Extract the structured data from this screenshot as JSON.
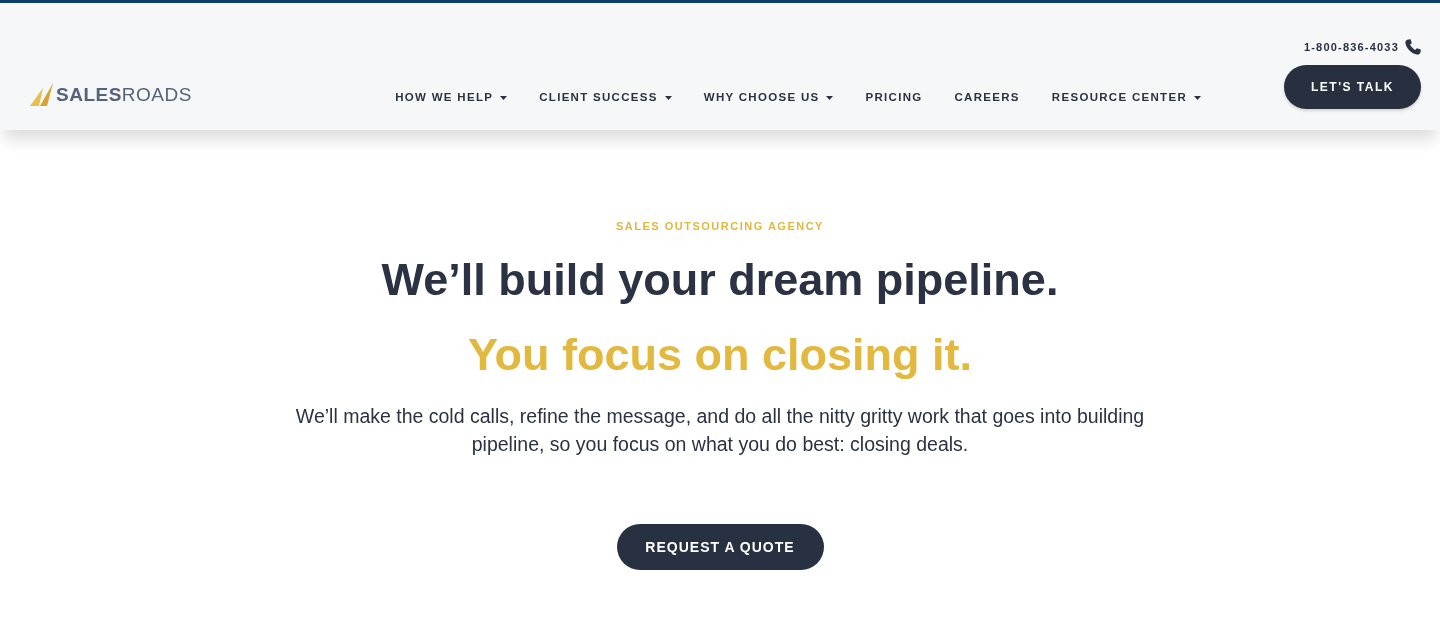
{
  "header": {
    "logo": {
      "wordmark": "**SALES**ROADS"
    },
    "nav": [
      {
        "label": "HOW WE HELP",
        "has_menu": true
      },
      {
        "label": "CLIENT SUCCESS",
        "has_menu": true
      },
      {
        "label": "WHY CHOOSE US",
        "has_menu": true
      },
      {
        "label": "PRICING",
        "has_menu": false
      },
      {
        "label": "CAREERS",
        "has_menu": false
      },
      {
        "label": "RESOURCE CENTER",
        "has_menu": true
      }
    ],
    "phone": "1-800-836-4033",
    "cta": "LET'S TALK"
  },
  "hero": {
    "eyebrow": "SALES OUTSOURCING AGENCY",
    "headline": "We’ll build your dream pipeline.",
    "subheadline": "You focus on closing it.",
    "body": "We’ll make the cold calls, refine the message, and do all the nitty gritty work that goes into building pipeline, so you focus on what you do best: closing deals.",
    "button": "REQUEST A QUOTE"
  }
}
